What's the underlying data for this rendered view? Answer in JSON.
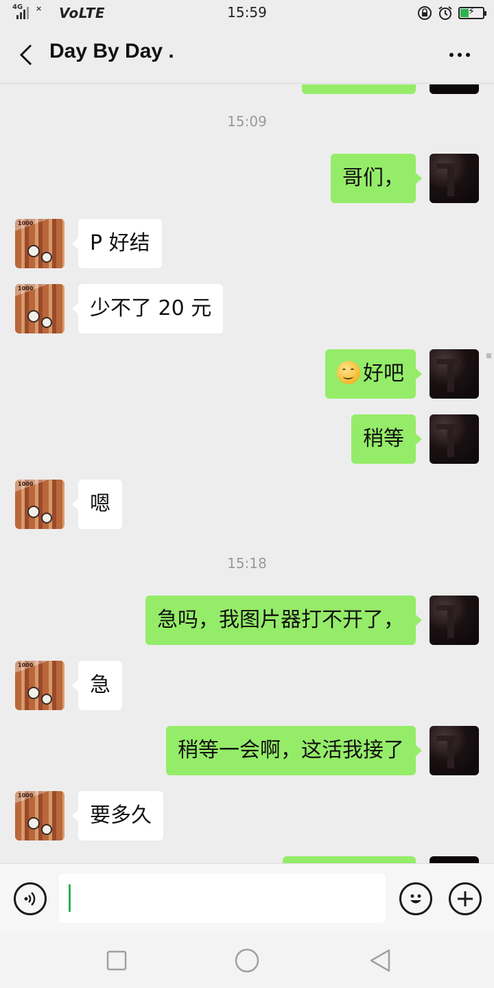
{
  "status_bar": {
    "network_tag": "4G",
    "volte": "VoLTE",
    "time": "15:59",
    "icons": [
      "lock-rotation-icon",
      "alarm-icon",
      "battery-charging-icon"
    ]
  },
  "nav": {
    "title": "Day By Day .",
    "back_icon": "chevron-left-icon",
    "more_icon": "more-dots-icon"
  },
  "messages": [
    {
      "type": "time",
      "text": "15:09"
    },
    {
      "type": "msg",
      "side": "me",
      "text": "哥们，"
    },
    {
      "type": "msg",
      "side": "other",
      "text": "P 好结"
    },
    {
      "type": "msg",
      "side": "other",
      "text": "少不了 20 元"
    },
    {
      "type": "msg",
      "side": "me",
      "emoji": "smile-emoji",
      "text": "好吧"
    },
    {
      "type": "msg",
      "side": "me",
      "text": "稍等"
    },
    {
      "type": "msg",
      "side": "other",
      "text": "嗯"
    },
    {
      "type": "time",
      "text": "15:18"
    },
    {
      "type": "msg",
      "side": "me",
      "text": "急吗，我图片器打不开了，"
    },
    {
      "type": "msg",
      "side": "other",
      "text": "急"
    },
    {
      "type": "msg",
      "side": "me",
      "text": "稍等一会啊，这活我接了"
    },
    {
      "type": "msg",
      "side": "other",
      "text": "要多久"
    }
  ],
  "input_bar": {
    "input_value": "",
    "voice_icon": "voice-icon",
    "emoji_icon": "emoji-icon",
    "plus_icon": "plus-icon"
  },
  "system_nav": {
    "icons": [
      "recent-apps-icon",
      "home-icon",
      "back-triangle-icon"
    ]
  },
  "colors": {
    "background": "#ededed",
    "my_bubble": "#95ec69",
    "other_bubble": "#ffffff",
    "accent": "#2bb24c"
  }
}
